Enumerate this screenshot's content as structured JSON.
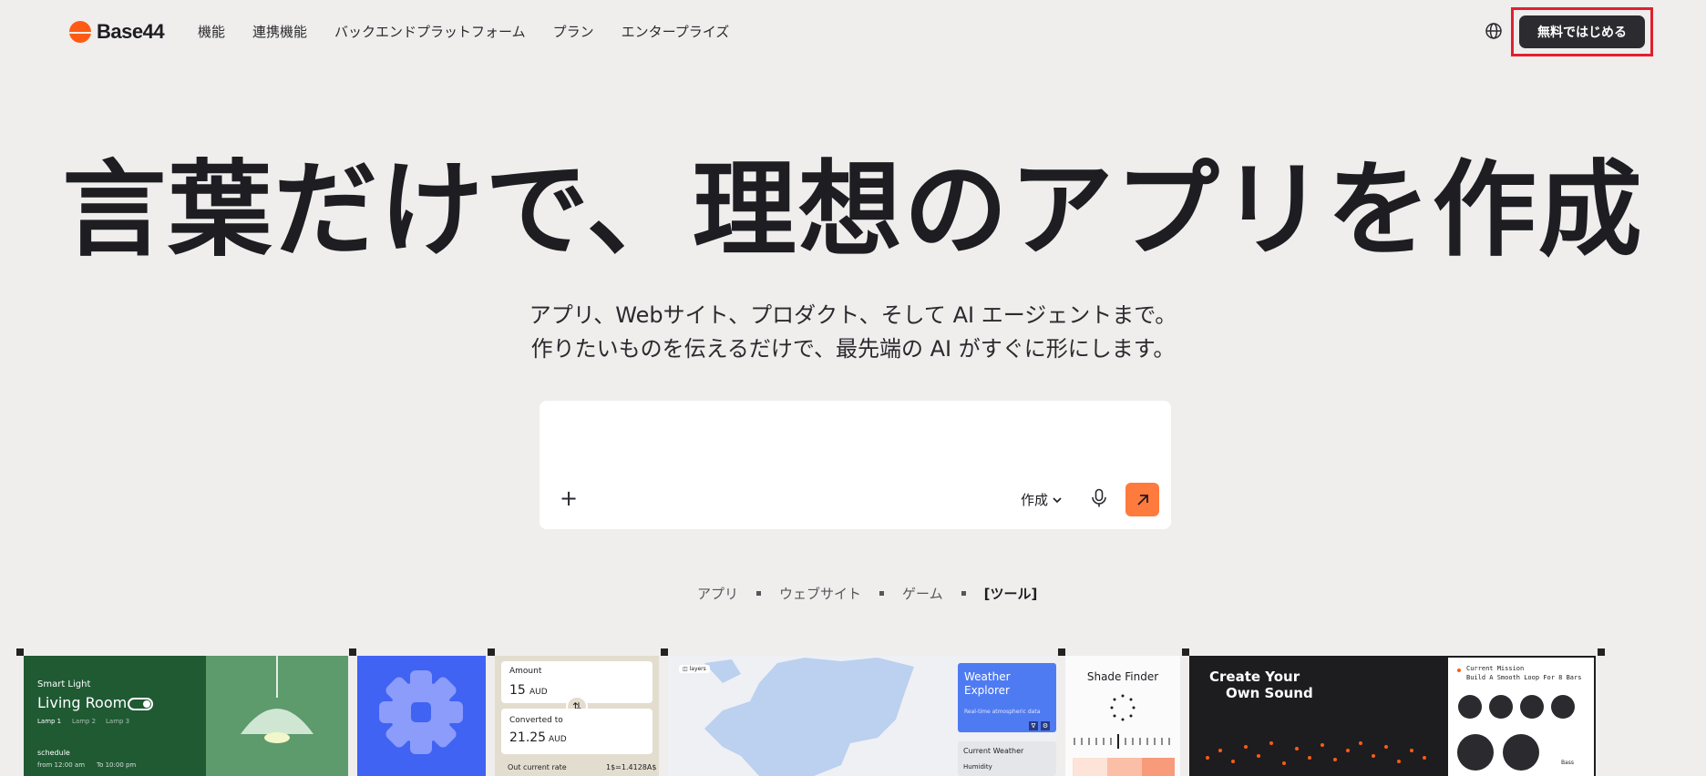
{
  "brand": {
    "name": "Base44",
    "color": "#ff5b14"
  },
  "nav": {
    "items": [
      {
        "label": "機能"
      },
      {
        "label": "連携機能"
      },
      {
        "label": "バックエンドプラットフォーム"
      },
      {
        "label": "プラン"
      },
      {
        "label": "エンタープライズ"
      }
    ],
    "globe_icon": "globe-icon",
    "cta_label": "無料ではじめる"
  },
  "hero": {
    "title": "言葉だけで、理想のアプリを作成",
    "subtitle_line1": "アプリ、Webサイト、プロダクト、そして AI エージェントまで。",
    "subtitle_line2": "作りたいものを伝えるだけで、最先端の AI がすぐに形にします。"
  },
  "prompt": {
    "value": "",
    "placeholder": "",
    "add_icon": "plus-icon",
    "mode_label": "作成",
    "mic_icon": "microphone-icon",
    "send_icon": "arrow-up-right-icon",
    "send_color": "#ff7a3d"
  },
  "categories": {
    "items": [
      {
        "label": "アプリ"
      },
      {
        "label": "ウェブサイト"
      },
      {
        "label": "ゲーム"
      },
      {
        "label": "[ツール]"
      }
    ],
    "active_index": 3
  },
  "gallery": {
    "smart_light": {
      "title": "Smart Light",
      "room": "Living Room",
      "tabs": [
        "Lamp 1",
        "Lamp 2",
        "Lamp 3"
      ],
      "schedule_label": "schedule",
      "from": "from 12:00 am",
      "to": "To 10:00 pm"
    },
    "converter": {
      "amount_label": "Amount",
      "amount_value": "15",
      "amount_unit": "AUD",
      "converted_label": "Converted to",
      "converted_value": "21.25",
      "converted_unit": "AUD",
      "rate_label": "Out current rate",
      "rate_value": "1$=1.4128A$"
    },
    "weather": {
      "layers_label": "layers",
      "title": "Weather Explorer",
      "subtitle": "Real-time atmospheric data",
      "current_label": "Current Weather",
      "humidity_label": "Humidity"
    },
    "shade": {
      "title": "Shade Finder"
    },
    "sound": {
      "title_line1": "Create Your",
      "title_line2": "Own Sound",
      "mission_label": "Current Mission",
      "mission_text": "Build A Smooth Loop For 8 Bars",
      "legend_1": "Bass"
    }
  }
}
